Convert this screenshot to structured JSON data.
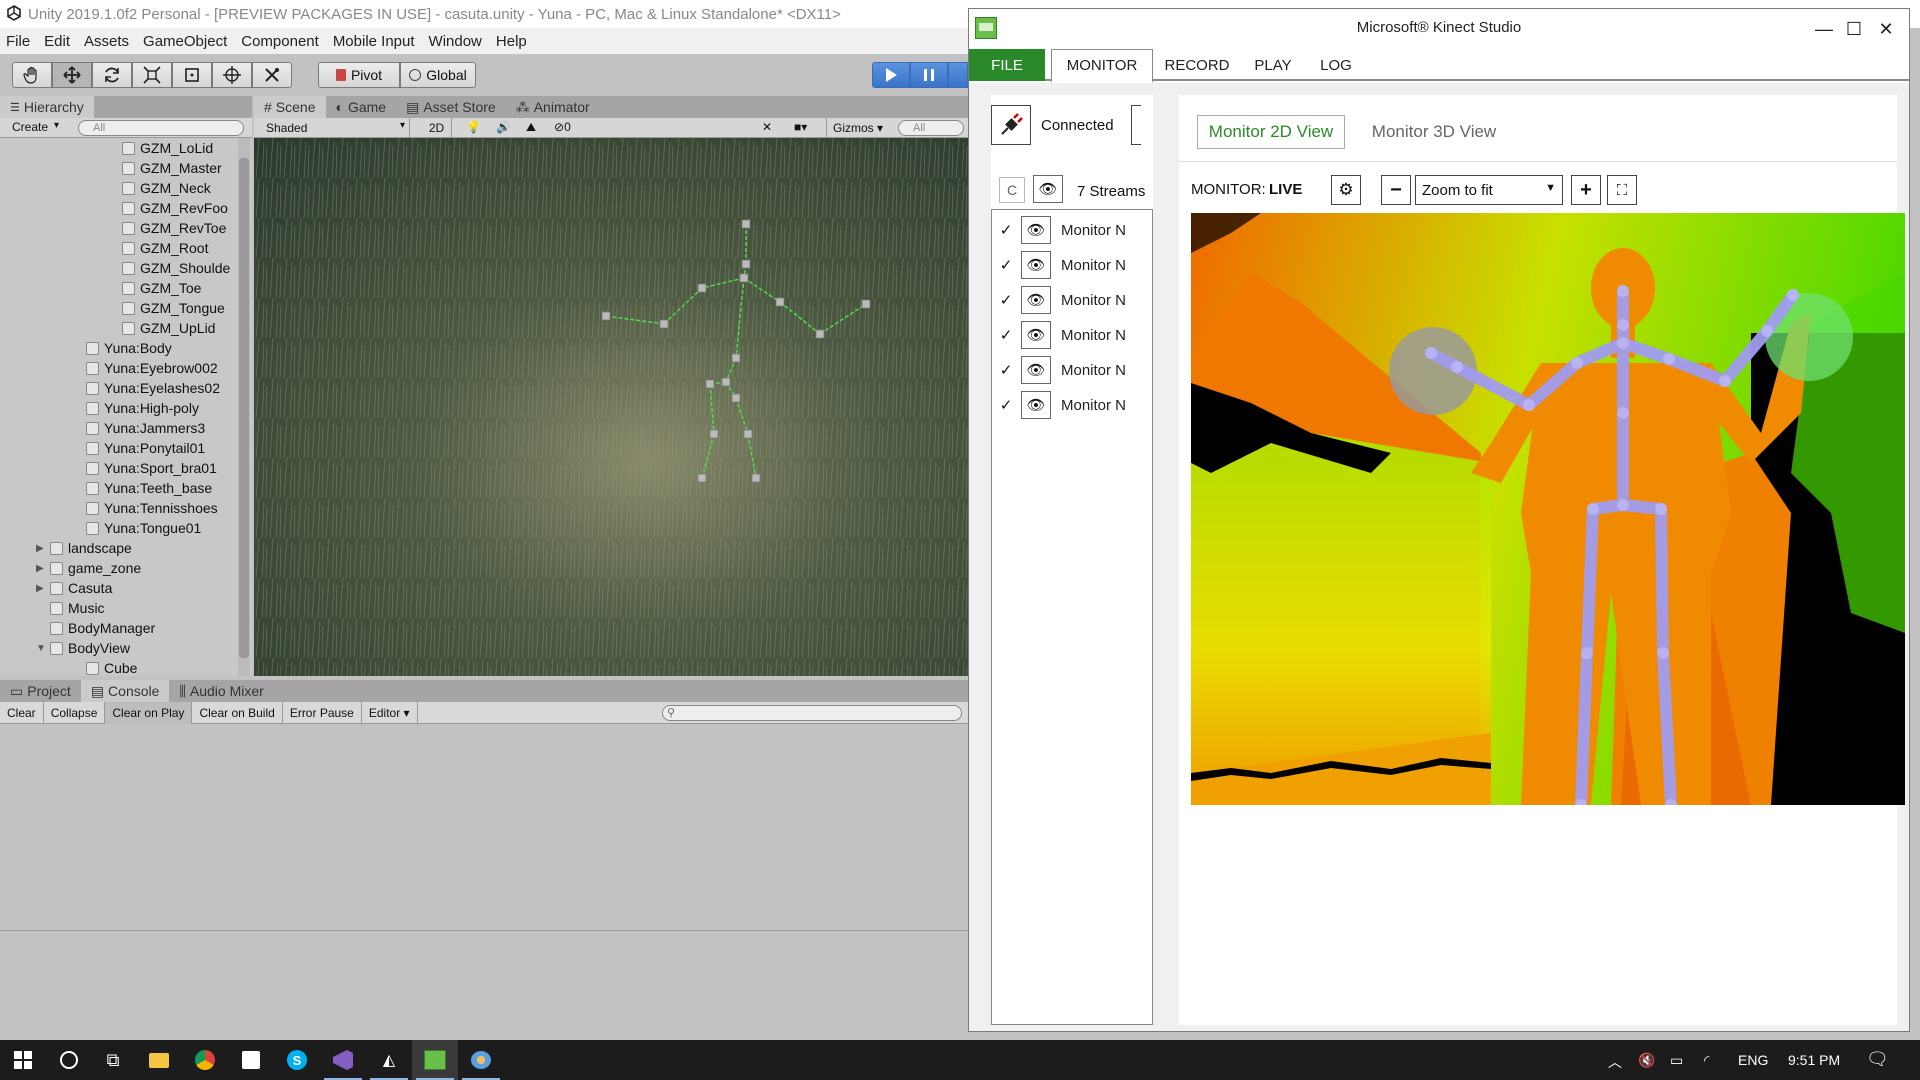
{
  "unity": {
    "title": "Unity 2019.1.0f2 Personal - [PREVIEW PACKAGES IN USE] - casuta.unity - Yuna - PC, Mac & Linux Standalone* <DX11>",
    "menu": [
      "File",
      "Edit",
      "Assets",
      "GameObject",
      "Component",
      "Mobile Input",
      "Window",
      "Help"
    ],
    "toolbar": {
      "pivot": "Pivot",
      "global": "Global"
    },
    "hierarchy": {
      "tab": "Hierarchy",
      "create": "Create",
      "search_placeholder": "All",
      "items": [
        {
          "label": "GZM_LoLid",
          "indent": 2
        },
        {
          "label": "GZM_Master",
          "indent": 2
        },
        {
          "label": "GZM_Neck",
          "indent": 2
        },
        {
          "label": "GZM_RevFoo",
          "indent": 2
        },
        {
          "label": "GZM_RevToe",
          "indent": 2
        },
        {
          "label": "GZM_Root",
          "indent": 2
        },
        {
          "label": "GZM_Shoulde",
          "indent": 2
        },
        {
          "label": "GZM_Toe",
          "indent": 2
        },
        {
          "label": "GZM_Tongue",
          "indent": 2
        },
        {
          "label": "GZM_UpLid",
          "indent": 2
        },
        {
          "label": "Yuna:Body",
          "indent": 1
        },
        {
          "label": "Yuna:Eyebrow002",
          "indent": 1
        },
        {
          "label": "Yuna:Eyelashes02",
          "indent": 1
        },
        {
          "label": "Yuna:High-poly",
          "indent": 1
        },
        {
          "label": "Yuna:Jammers3",
          "indent": 1
        },
        {
          "label": "Yuna:Ponytail01",
          "indent": 1
        },
        {
          "label": "Yuna:Sport_bra01",
          "indent": 1
        },
        {
          "label": "Yuna:Teeth_base",
          "indent": 1
        },
        {
          "label": "Yuna:Tennisshoes",
          "indent": 1
        },
        {
          "label": "Yuna:Tongue01",
          "indent": 1
        },
        {
          "label": "landscape",
          "indent": 0,
          "arrow": "right"
        },
        {
          "label": "game_zone",
          "indent": 0,
          "arrow": "right"
        },
        {
          "label": "Casuta",
          "indent": 0,
          "arrow": "right"
        },
        {
          "label": "Music",
          "indent": 0
        },
        {
          "label": "BodyManager",
          "indent": 0
        },
        {
          "label": "BodyView",
          "indent": 0,
          "arrow": "down"
        },
        {
          "label": "Cube",
          "indent": 1
        }
      ]
    },
    "scene": {
      "tabs": [
        "Scene",
        "Game",
        "Asset Store",
        "Animator"
      ],
      "shading": "Shaded",
      "mode_2d": "2D",
      "hidden_count": "0",
      "gizmos": "Gizmos",
      "search_placeholder": "All"
    },
    "console": {
      "tabs": [
        "Project",
        "Console",
        "Audio Mixer"
      ],
      "buttons": [
        "Clear",
        "Collapse",
        "Clear on Play",
        "Clear on Build",
        "Error Pause"
      ],
      "editor": "Editor"
    }
  },
  "kinect": {
    "title": "Microsoft® Kinect Studio",
    "menu": [
      "FILE",
      "MONITOR",
      "RECORD",
      "PLAY",
      "LOG"
    ],
    "connection": "Connected",
    "streams_count": "7 Streams",
    "streams": [
      "Monitor N",
      "Monitor N",
      "Monitor N",
      "Monitor N",
      "Monitor N",
      "Monitor N"
    ],
    "views": [
      "Monitor 2D View",
      "Monitor 3D View"
    ],
    "monitor_label": "MONITOR:",
    "monitor_state": "LIVE",
    "zoom": "Zoom to fit",
    "colors": {
      "accent_green": "#2a8a2a",
      "view_active": "#2a8a2a"
    }
  },
  "taskbar": {
    "lang": "ENG",
    "time": "9:51 PM"
  }
}
